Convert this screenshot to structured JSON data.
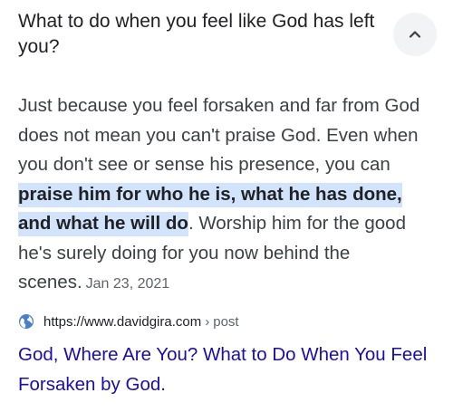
{
  "question": "What to do when you feel like God has left you?",
  "answer": {
    "text_before": "Just because you feel forsaken and far from God does not mean you can't praise God. Even when you don't see or sense his presence, you can ",
    "highlight": "praise him for who he is, what he has done, and what he will do",
    "text_after": ". Worship him for the good he's surely doing for you now behind the scenes.",
    "date": "Jan 23, 2021"
  },
  "source": {
    "url": "https://www.davidgira.com",
    "separator": "›",
    "path": "post"
  },
  "result_title": "God, Where Are You? What to Do When You Feel Forsaken by God.",
  "icons": {
    "collapse": "chevron-up-icon",
    "site": "globe-icon"
  },
  "colors": {
    "highlight_bg": "#d2e3fc",
    "link": "#1a0dab",
    "globe": "#4a80c9",
    "button_bg": "#f1f3f4"
  }
}
